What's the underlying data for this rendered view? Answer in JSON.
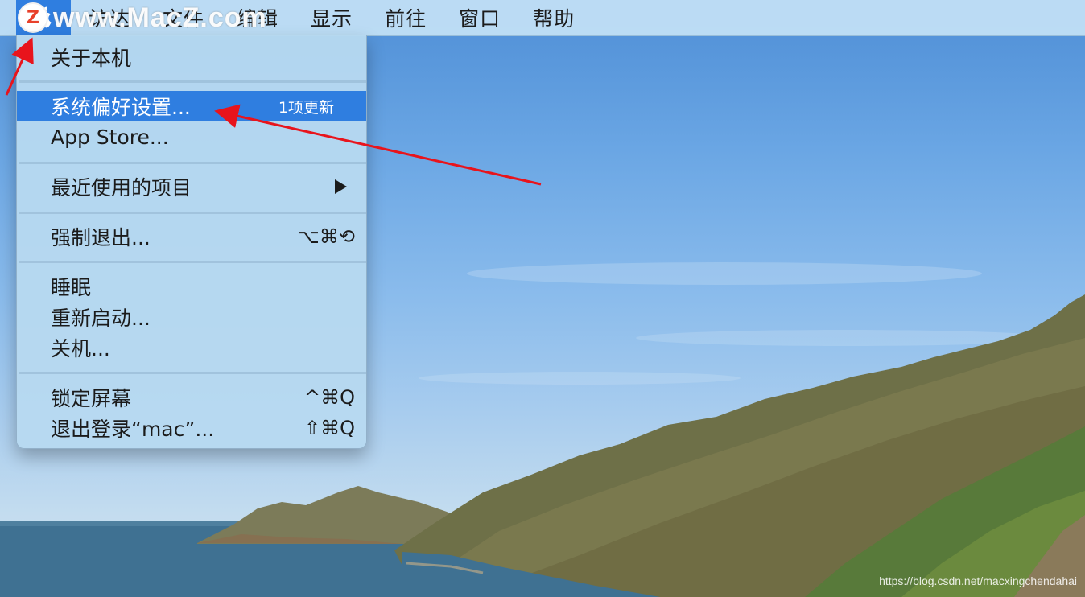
{
  "menubar": {
    "items": [
      "访达",
      "文件",
      "编辑",
      "显示",
      "前往",
      "窗口",
      "帮助"
    ]
  },
  "watermark": {
    "badge": "Z",
    "text": "www.MacZ.com"
  },
  "apple_menu": {
    "about": "关于本机",
    "system_prefs": "系统偏好设置...",
    "system_prefs_badge": "1项更新",
    "app_store": "App Store...",
    "recent_items": "最近使用的项目",
    "force_quit": "强制退出...",
    "force_quit_shortcut": "⌥⌘⟲",
    "sleep": "睡眠",
    "restart": "重新启动...",
    "shutdown": "关机...",
    "lock_screen": "锁定屏幕",
    "lock_shortcut": "^⌘Q",
    "logout": "退出登录“mac”...",
    "logout_shortcut": "⇧⌘Q"
  },
  "footer_credit": "https://blog.csdn.net/macxingchendahai",
  "colors": {
    "highlight": "#2f7ee0",
    "annotation_arrow": "#e8141c",
    "menubar": "#c4e2f6",
    "menu_bg": "#b7d9f0"
  },
  "icons": [
    "apple-logo-icon",
    "submenu-arrow-icon",
    "option-icon",
    "command-icon",
    "power-icon",
    "control-icon",
    "shift-icon"
  ]
}
